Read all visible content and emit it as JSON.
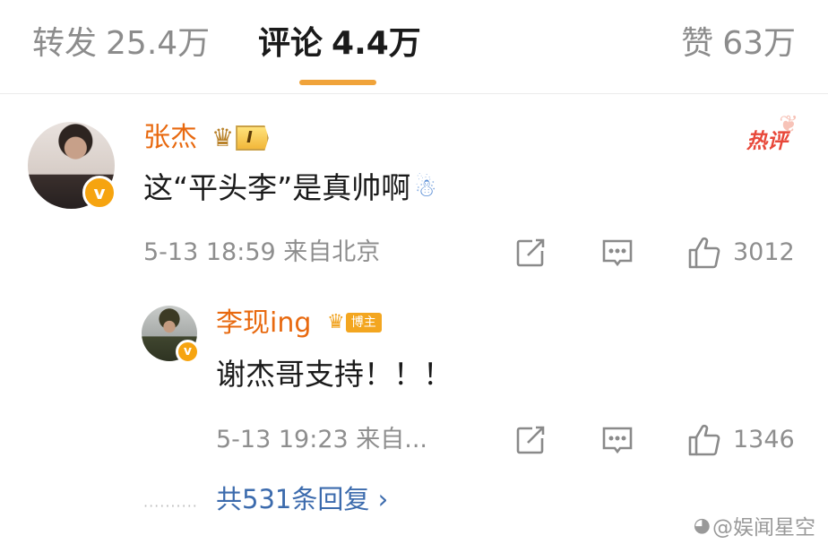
{
  "tabs": {
    "repost_label": "转发",
    "repost_count": "25.4万",
    "comments_label": "评论",
    "comments_count": "4.4万",
    "likes_label": "赞",
    "likes_count": "63万",
    "accent": "#f0a33a"
  },
  "comment": {
    "author": "张杰",
    "level_badge": "I",
    "hot_badge": "热评",
    "text": "这“平头李”是真帅啊",
    "time": "5-13 18:59",
    "location": "来自北京",
    "likes": "3012",
    "name_color": "#e8690f"
  },
  "reply": {
    "author": "李现ing",
    "badge": "博主",
    "text": "谢杰哥支持！！！",
    "time": "5-13 19:23",
    "location": "来自...",
    "likes": "1346"
  },
  "more_replies": "共531条回复",
  "watermark": "@娱闻星空",
  "icons": [
    "crown-icon",
    "verified-icon",
    "emoji-icon",
    "share-icon",
    "comment-icon",
    "like-icon",
    "chevron-right-icon",
    "weibo-logo-icon"
  ]
}
